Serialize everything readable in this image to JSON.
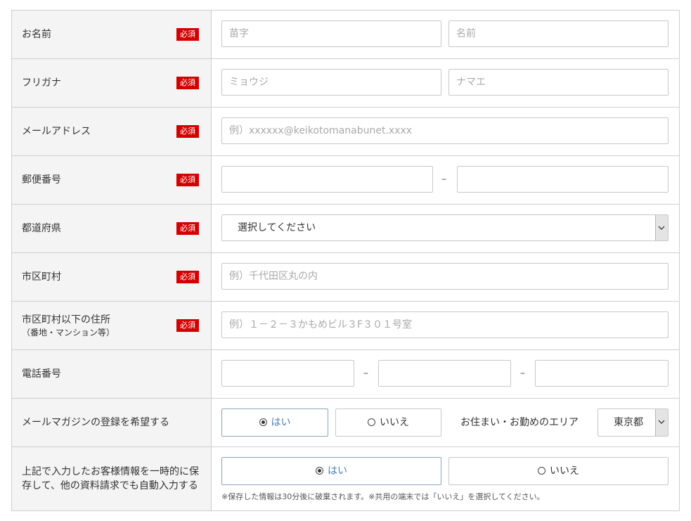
{
  "required_label": "必須",
  "rows": {
    "name": {
      "label": "お名前",
      "last_placeholder": "苗字",
      "first_placeholder": "名前"
    },
    "furigana": {
      "label": "フリガナ",
      "last_placeholder": "ミョウジ",
      "first_placeholder": "ナマエ"
    },
    "email": {
      "label": "メールアドレス",
      "placeholder": "例）xxxxxx@keikotomanabunet.xxxx"
    },
    "postal": {
      "label": "郵便番号",
      "separator": "–"
    },
    "prefecture": {
      "label": "都道府県",
      "selected": "選択してください"
    },
    "city": {
      "label": "市区町村",
      "placeholder": "例）千代田区丸の内"
    },
    "address": {
      "label": "市区町村以下の住所",
      "sublabel": "（番地・マンション等）",
      "placeholder": "例）１－２－３かもめビル３F３０１号室"
    },
    "phone": {
      "label": "電話番号",
      "separator": "–"
    },
    "magazine": {
      "label": "メールマガジンの登録を希望する",
      "yes": "はい",
      "no": "いいえ",
      "area_label": "お住まい・お勤めのエリア",
      "area_selected": "東京都"
    },
    "save": {
      "label_line1": "上記で入力したお客様情報を一時的に保",
      "label_line2": "存して、他の資料請求でも自動入力する",
      "yes": "はい",
      "no": "いいえ",
      "note": "※保存した情報は30分後に破棄されます。※共用の端末では「いいえ」を選択してください。"
    }
  },
  "colors": {
    "required_bg": "#d40000",
    "label_bg": "#f4f4f4",
    "active_radio": "#4a7fb7"
  },
  "icons": {
    "select_arrow": "chevron-down-icon",
    "radio": "radio-icon"
  }
}
